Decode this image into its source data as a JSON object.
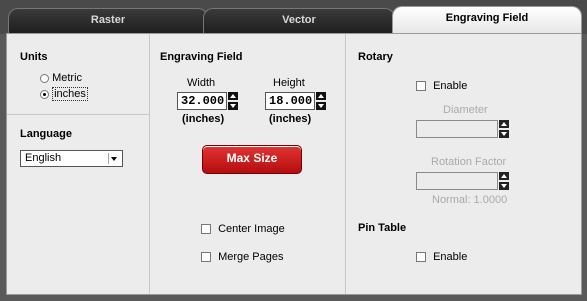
{
  "tabs": [
    {
      "label": "Raster"
    },
    {
      "label": "Vector"
    },
    {
      "label": "Engraving Field"
    }
  ],
  "units": {
    "heading": "Units",
    "options": [
      {
        "label": "Metric",
        "selected": false
      },
      {
        "label": "inches",
        "selected": true
      }
    ]
  },
  "language": {
    "heading": "Language",
    "selected": "English"
  },
  "engraving_field": {
    "heading": "Engraving Field",
    "width_label": "Width",
    "width_value": "32.000",
    "width_unit": "(inches)",
    "height_label": "Height",
    "height_value": "18.000",
    "height_unit": "(inches)",
    "max_size_label": "Max Size",
    "center_image_label": "Center Image",
    "merge_pages_label": "Merge Pages"
  },
  "rotary": {
    "heading": "Rotary",
    "enable_label": "Enable",
    "diameter_label": "Diameter",
    "rotation_factor_label": "Rotation Factor",
    "normal_label": "Normal: 1.0000"
  },
  "pin_table": {
    "heading": "Pin Table",
    "enable_label": "Enable"
  },
  "colors": {
    "accent_button": "#c81a1a",
    "tab_active": "#f2f2f2",
    "tab_inactive": "#2a2a2a"
  }
}
